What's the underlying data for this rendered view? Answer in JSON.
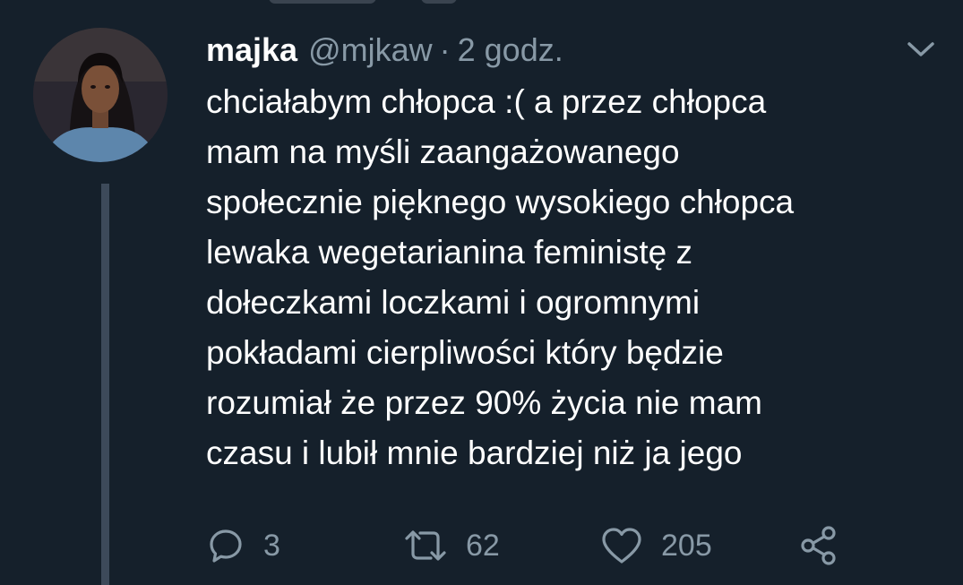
{
  "tweet": {
    "display_name": "majka",
    "handle": "@mjkaw",
    "separator": "·",
    "timestamp": "2 godz.",
    "text_lines": [
      "chciałabym chłopca :( a przez chłopca",
      "mam na myśli zaangażowanego",
      "społecznie pięknego wysokiego chłopca",
      "lewaka wegetarianina feministę z",
      "dołeczkami loczkami i ogromnymi",
      "pokładami cierpliwości który będzie",
      "rozumiał że przez 90% życia nie mam",
      "czasu i lubił mnie bardziej niż ja jego"
    ]
  },
  "actions": {
    "reply": {
      "icon": "reply-icon",
      "count": "3"
    },
    "retweet": {
      "icon": "retweet-icon",
      "count": "62"
    },
    "like": {
      "icon": "heart-icon",
      "count": "205"
    },
    "share": {
      "icon": "share-icon"
    }
  },
  "colors": {
    "background": "#15202b",
    "primary_text": "#ffffff",
    "secondary_text": "#8899a6",
    "thread_line": "#3d4a5a"
  }
}
